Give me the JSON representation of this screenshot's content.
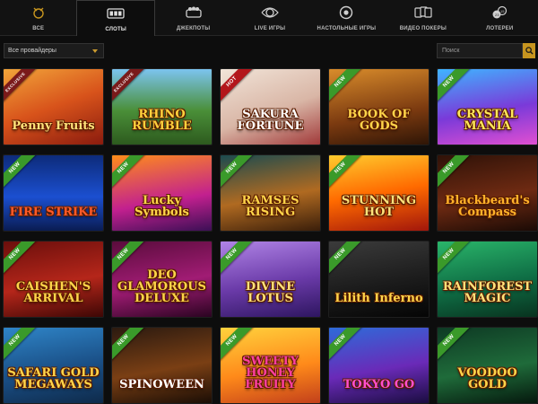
{
  "nav": {
    "tabs": [
      {
        "label": "ВСЕ",
        "icon": "all-games-icon",
        "active": false
      },
      {
        "label": "СЛОТЫ",
        "icon": "slot-machine-icon",
        "active": true
      },
      {
        "label": "ДЖЕКПОТЫ",
        "icon": "jackpot-icon",
        "active": false
      },
      {
        "label": "LIVE ИГРЫ",
        "icon": "live-games-icon",
        "active": false
      },
      {
        "label": "НАСТОЛЬНЫЕ ИГРЫ",
        "icon": "table-games-icon",
        "active": false
      },
      {
        "label": "ВИДЕО ПОКЕРЫ",
        "icon": "video-poker-icon",
        "active": false
      },
      {
        "label": "ЛОТЕРЕИ",
        "icon": "lottery-icon",
        "active": false
      }
    ]
  },
  "filters": {
    "provider_value": "Все провайдеры",
    "search_placeholder": "Поиск"
  },
  "colors": {
    "accent": "#c7951f",
    "new_badge": "#3a9a2a",
    "hot_badge": "#b3161b"
  },
  "games": [
    {
      "title": "Penny Fruits",
      "badge": "EXCLUSIVE",
      "bg": "linear-gradient(160deg,#f2a53a 0%,#d8531b 50%,#8a1b0e 100%)",
      "color": "#ffe27a"
    },
    {
      "title": "RHINO RUMBLE",
      "badge": "EXCLUSIVE",
      "bg": "linear-gradient(180deg,#7cc4f0 0%,#4a8f38 55%,#2d5a1e 100%)",
      "color": "#ffd23d"
    },
    {
      "title": "SAKURA FORTUNE",
      "badge": "HOT",
      "bg": "linear-gradient(160deg,#f1e4d8 0%,#d9b6a6 55%,#a13a3a 100%)",
      "color": "#ffffff"
    },
    {
      "title": "BOOK OF GODS",
      "badge": "NEW",
      "bg": "linear-gradient(170deg,#d98c2b 0%,#7b3a10 60%,#2e1506 100%)",
      "color": "#ffd54a"
    },
    {
      "title": "CRYSTAL MANIA",
      "badge": "NEW",
      "bg": "linear-gradient(170deg,#3fb4ff 0%,#7a3ad9 55%,#e14fd1 100%)",
      "color": "#ffe85a"
    },
    {
      "title": "FIRE STRIKE",
      "badge": "NEW",
      "bg": "linear-gradient(180deg,#0d2b7a 0%,#1b4fd0 55%,#0a1c52 100%)",
      "color": "#ff5a2a"
    },
    {
      "title": "Lucky Symbols",
      "badge": "NEW",
      "bg": "linear-gradient(170deg,#ff8d1a 0%,#c2208f 60%,#3b0f55 100%)",
      "color": "#ffd54a"
    },
    {
      "title": "RAMSES RISING",
      "badge": "NEW",
      "bg": "linear-gradient(170deg,#1c4b4f 0%,#b06a21 55%,#3a1e0a 100%)",
      "color": "#ffd54a"
    },
    {
      "title": "STUNNING HOT",
      "badge": "NEW",
      "bg": "linear-gradient(170deg,#ffcc2e 0%,#ff6a00 50%,#a1160b 100%)",
      "color": "#ffe27a"
    },
    {
      "title": "Blackbeard's Compass",
      "badge": "NEW",
      "bg": "linear-gradient(170deg,#2f1208 0%,#6e2a12 55%,#1a0a05 100%)",
      "color": "#ffb22a"
    },
    {
      "title": "CAISHEN'S ARRIVAL",
      "badge": "NEW",
      "bg": "linear-gradient(170deg,#6b0f0c 0%,#b5261a 55%,#3d0705 100%)",
      "color": "#ffd54a"
    },
    {
      "title": "DEO GLAMOROUS DELUXE",
      "badge": "NEW",
      "bg": "linear-gradient(170deg,#5a0c3c 0%,#a11c74 55%,#2a0421 100%)",
      "color": "#ffd54a"
    },
    {
      "title": "DIVINE LOTUS",
      "badge": "NEW",
      "bg": "linear-gradient(170deg,#b084e6 0%,#6a3aa8 55%,#2e1660 100%)",
      "color": "#ffe27a"
    },
    {
      "title": "Lilith Inferno",
      "badge": "NEW",
      "bg": "linear-gradient(170deg,#3b3b3b 0%,#1c1c1c 55%,#050505 100%)",
      "color": "#ffd54a"
    },
    {
      "title": "RAINFOREST MAGIC",
      "badge": "NEW",
      "bg": "linear-gradient(170deg,#2ab56a 0%,#0f6e45 55%,#08331f 100%)",
      "color": "#ffe27a"
    },
    {
      "title": "SAFARI GOLD MEGAWAYS",
      "badge": "NEW",
      "bg": "linear-gradient(170deg,#2f85c8 0%,#1a4f86 55%,#0e2a4a 100%)",
      "color": "#ffd54a"
    },
    {
      "title": "SPINOWEEN",
      "badge": "NEW",
      "bg": "linear-gradient(170deg,#2b1a10 0%,#7a3f14 55%,#1a0d05 100%)",
      "color": "#ffffff"
    },
    {
      "title": "SWEETY HONEY FRUITY",
      "badge": "NEW",
      "bg": "linear-gradient(170deg,#ffd23d 0%,#ff8a1a 55%,#c2401b 100%)",
      "color": "#ff3fa0"
    },
    {
      "title": "TOKYO GO",
      "badge": "NEW",
      "bg": "linear-gradient(170deg,#2e6bd9 0%,#6a2ab8 55%,#1a0d40 100%)",
      "color": "#ff4fd1"
    },
    {
      "title": "VOODOO GOLD",
      "badge": "NEW",
      "bg": "linear-gradient(170deg,#0e3a24 0%,#1f6b3a 55%,#05180d 100%)",
      "color": "#ffd54a"
    }
  ]
}
